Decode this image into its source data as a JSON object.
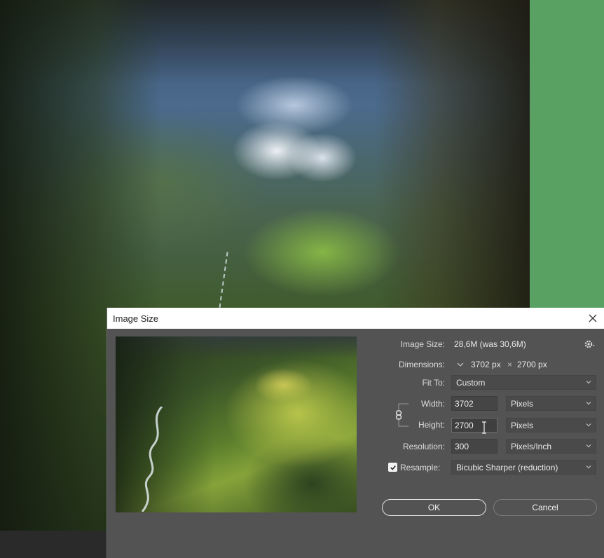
{
  "dialog": {
    "title": "Image Size",
    "image_size_label": "Image Size:",
    "image_size_value": "28,6M (was 30,6M)",
    "dimensions_label": "Dimensions:",
    "dimensions_width": "3702 px",
    "dimensions_separator": "×",
    "dimensions_height": "2700 px",
    "fit_to_label": "Fit To:",
    "fit_to_value": "Custom",
    "width_label": "Width:",
    "width_value": "3702",
    "width_unit": "Pixels",
    "height_label": "Height:",
    "height_value": "2700",
    "height_unit": "Pixels",
    "resolution_label": "Resolution:",
    "resolution_value": "300",
    "resolution_unit": "Pixels/Inch",
    "resample_label": "Resample:",
    "resample_checked": true,
    "resample_value": "Bicubic Sharper (reduction)",
    "ok_label": "OK",
    "cancel_label": "Cancel"
  },
  "icons": {
    "close": "close-icon",
    "settings": "gear-icon",
    "dimensions": "chevron-down-icon",
    "constrain": "link-icon",
    "dropdown": "chevron-down-icon",
    "checkbox": "checkmark-icon"
  },
  "colors": {
    "dialog_bg": "#535353",
    "titlebar_bg": "#ffffff",
    "green_panel": "#58a163",
    "field_bg": "#454545",
    "text": "#e8e8e8"
  }
}
